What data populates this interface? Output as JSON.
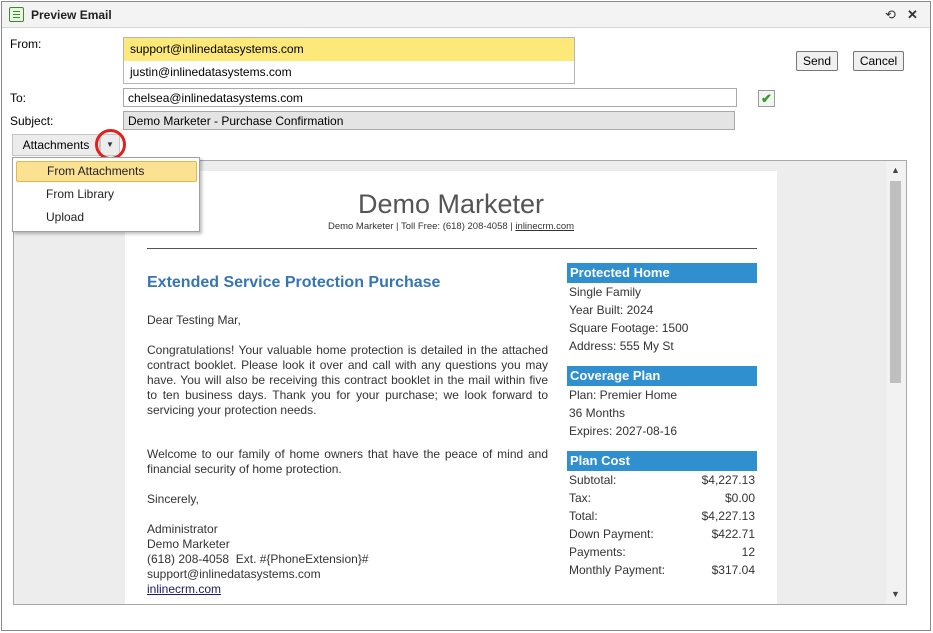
{
  "window": {
    "title": "Preview Email",
    "refresh_icon": "refresh-icon",
    "close_icon": "close-icon"
  },
  "form": {
    "from_label": "From:",
    "from_options": [
      "support@inlinedatasystems.com",
      "justin@inlinedatasystems.com"
    ],
    "to_label": "To:",
    "to_value": "chelsea@inlinedatasystems.com",
    "subject_label": "Subject:",
    "subject_value": "Demo Marketer - Purchase Confirmation",
    "send_label": "Send",
    "cancel_label": "Cancel"
  },
  "attachments": {
    "button_label": "Attachments",
    "menu": [
      "From Attachments",
      "From Library",
      "Upload"
    ]
  },
  "email": {
    "brand": "Demo Marketer",
    "tagline_prefix": "Demo Marketer | Toll Free: (618) 208-4058 | ",
    "tagline_link": "inlinecrm.com",
    "heading": "Extended Service Protection Purchase",
    "greeting": "Dear Testing Mar,",
    "paragraph1": "Congratulations! Your valuable home protection is detailed in the attached contract booklet. Please look it over and call with any questions you may have. You will also be receiving this contract booklet in the mail within five to ten business days. Thank you for your purchase; we look forward to servicing your protection needs.",
    "paragraph2": "Welcome to our family of home owners that have the peace of mind and financial security of home protection.",
    "closing": "Sincerely,",
    "signature": [
      "Administrator",
      "Demo Marketer",
      "(618) 208-4058  Ext. #{PhoneExtension}#",
      "support@inlinedatasystems.com"
    ],
    "signature_link": "inlinecrm.com",
    "protected_home": {
      "title": "Protected Home",
      "lines": [
        "Single Family",
        "Year Built: 2024",
        "Square Footage: 1500",
        "Address: 555 My St"
      ]
    },
    "coverage_plan": {
      "title": "Coverage Plan",
      "lines": [
        "Plan: Premier Home",
        "36 Months",
        "Expires: 2027-08-16"
      ]
    },
    "plan_cost": {
      "title": "Plan Cost",
      "rows": [
        {
          "label": "Subtotal:",
          "value": "$4,227.13"
        },
        {
          "label": "Tax:",
          "value": "$0.00"
        },
        {
          "label": "Total:",
          "value": "$4,227.13"
        },
        {
          "label": "Down Payment:",
          "value": "$422.71"
        },
        {
          "label": "Payments:",
          "value": "12"
        },
        {
          "label": "Monthly Payment:",
          "value": "$317.04"
        }
      ]
    }
  }
}
